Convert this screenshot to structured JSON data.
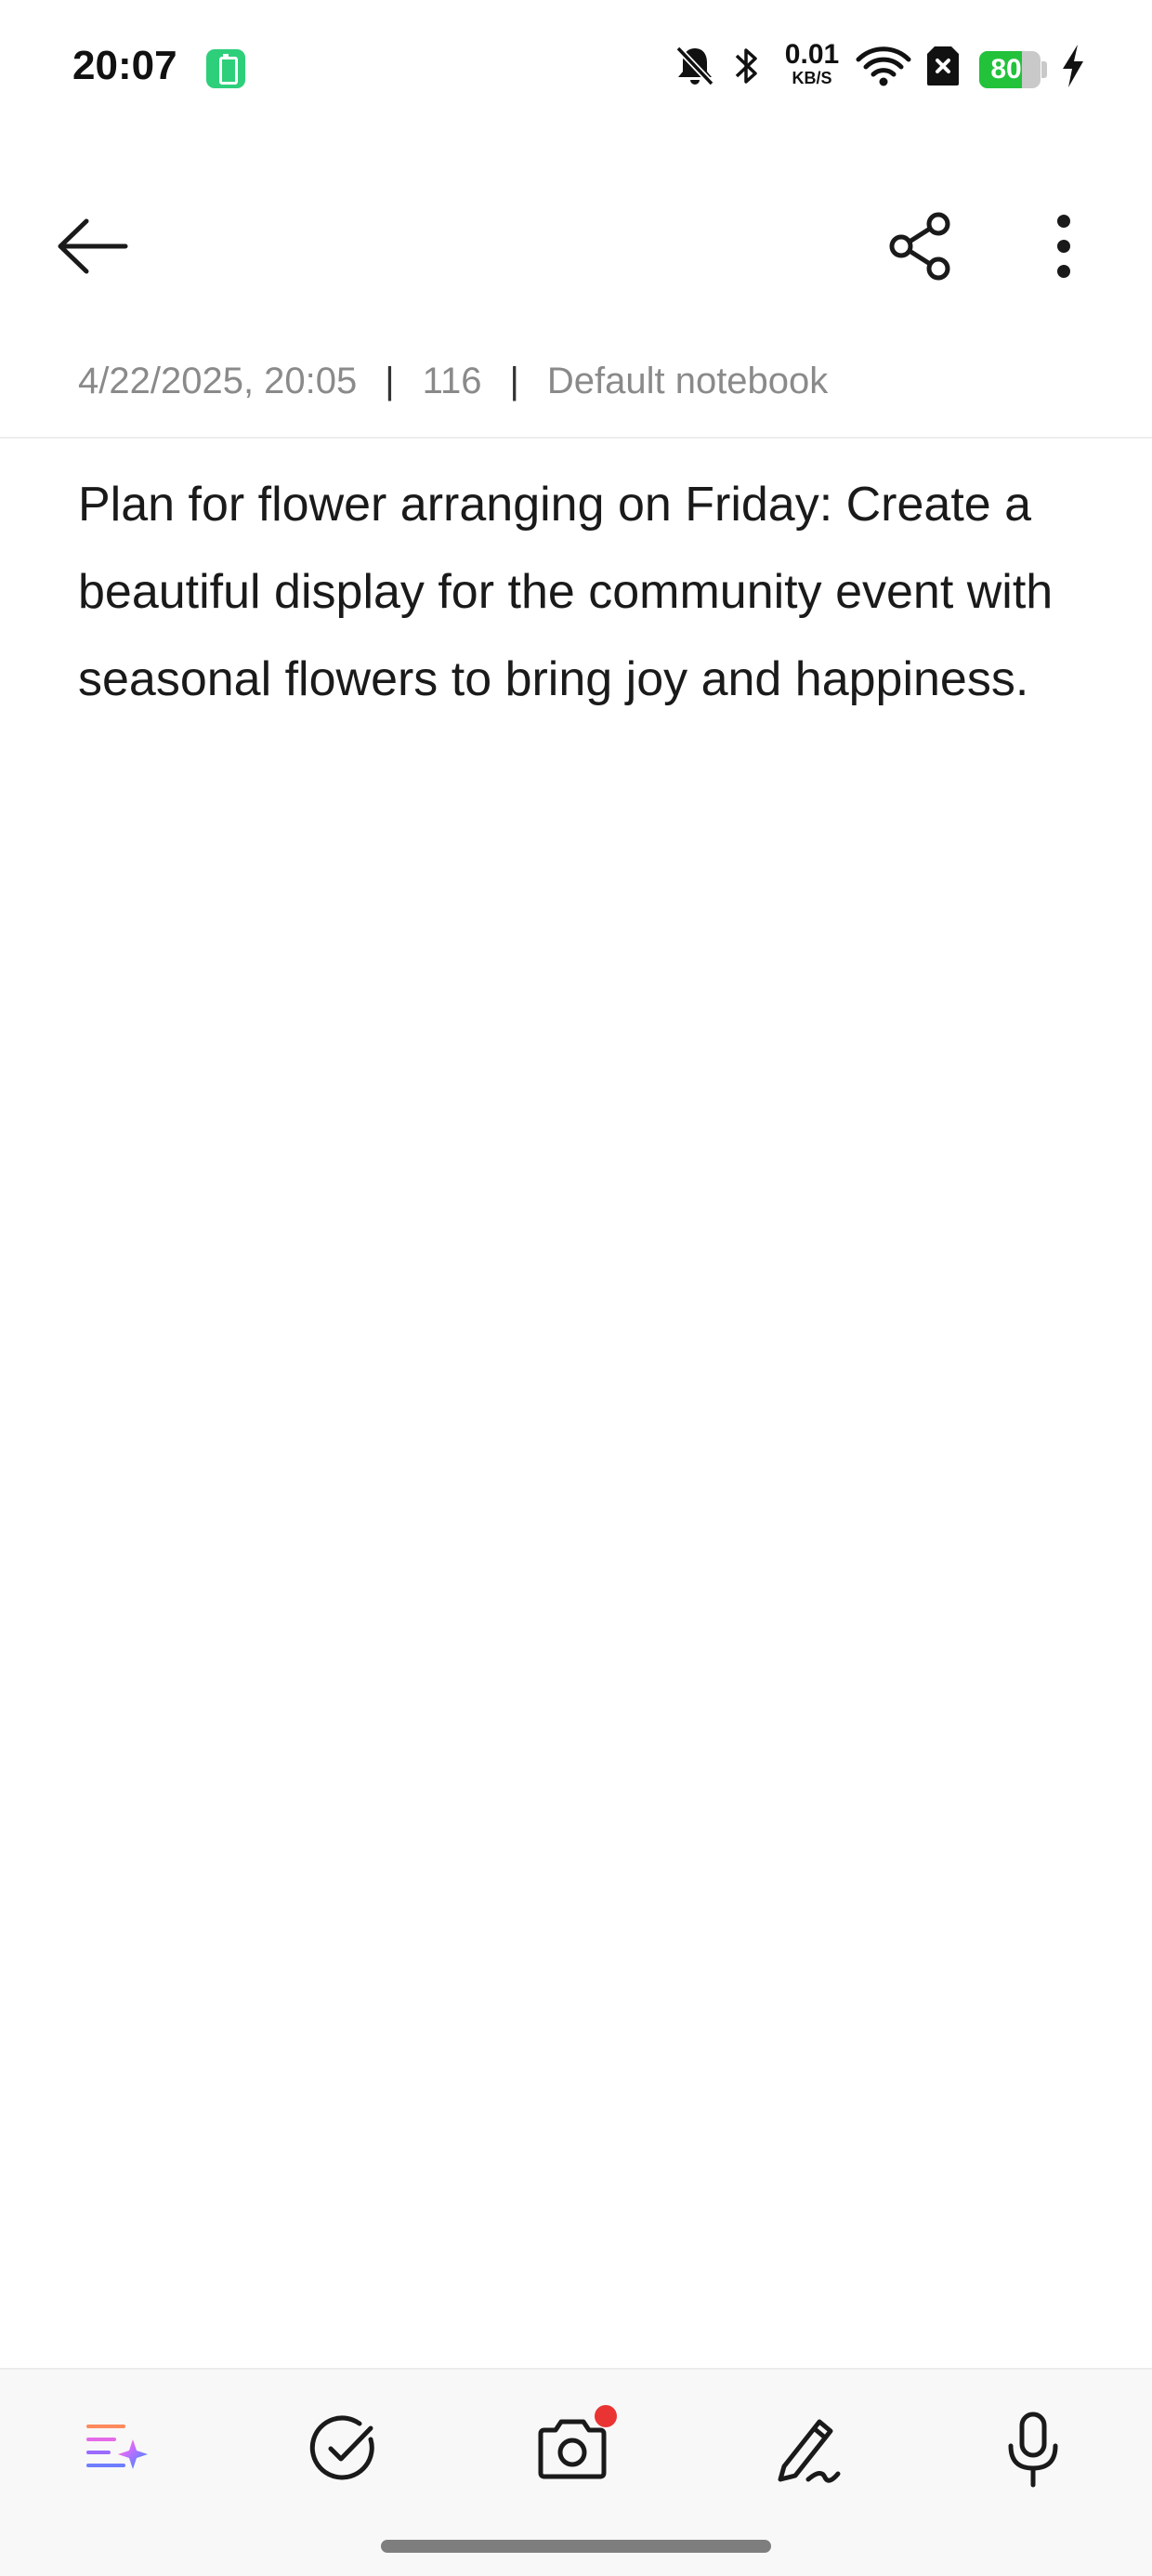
{
  "status_bar": {
    "time": "20:07",
    "net_speed_value": "0.01",
    "net_speed_unit": "KB/S",
    "battery_level": "80",
    "battery_fraction": 0.8,
    "icons": [
      "battery-saver-icon",
      "bell-off-icon",
      "bluetooth-icon",
      "wifi-icon",
      "sim-error-icon",
      "charging-bolt-icon"
    ]
  },
  "header": {
    "icons": [
      "back-arrow-icon",
      "share-icon",
      "more-vertical-icon"
    ]
  },
  "meta": {
    "date": "4/22/2025, 20:05",
    "separator": "|",
    "char_count": "116",
    "notebook": "Default notebook"
  },
  "note": {
    "text": "Plan for flower arranging on Friday: Create a beautiful display for the community event with seasonal flowers to bring joy and happiness."
  },
  "toolbar": {
    "icons": [
      "ai-format-icon",
      "checklist-icon",
      "camera-icon",
      "handwriting-pen-icon",
      "microphone-icon"
    ]
  },
  "colors": {
    "battery_green": "#22c23b",
    "saver_green": "#2ecf7a",
    "meta_gray": "#8a8a8a",
    "notification_dot": "#ea3333",
    "toolbar_bg": "#f8f8f8"
  }
}
